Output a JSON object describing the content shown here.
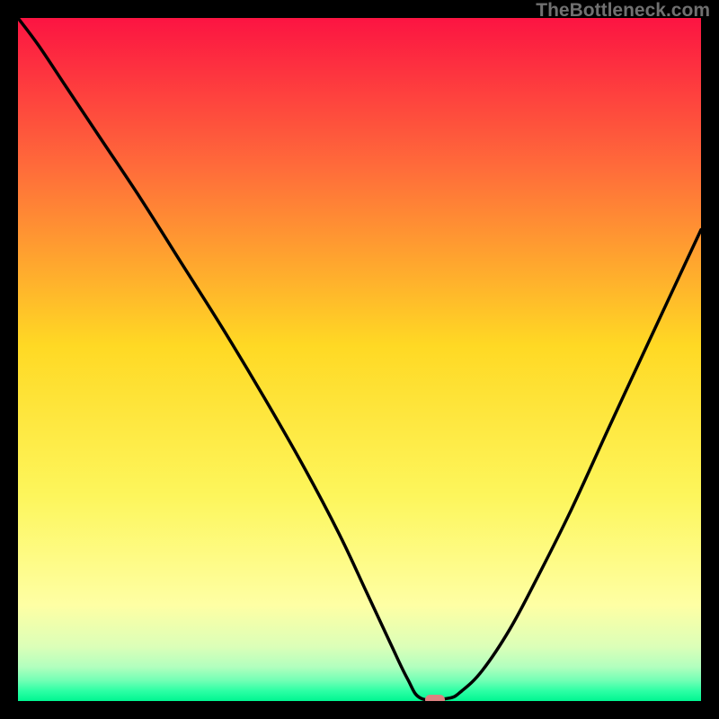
{
  "watermark": "TheBottleneck.com",
  "colors": {
    "top": "#fc1442",
    "mid_upper": "#ff6c3a",
    "mid": "#ffd924",
    "mid_lower": "#fdf65c",
    "pale_yellow": "#feffa4",
    "pale_green1": "#dcffb8",
    "pale_green2": "#b2ffbe",
    "green1": "#72ffb5",
    "green2": "#2dffa5",
    "green3": "#00f691",
    "pill": "#dd8181",
    "curve": "#000000",
    "border": "#000000"
  },
  "chart_data": {
    "type": "line",
    "title": "",
    "xlabel": "",
    "ylabel": "",
    "xlim": [
      0,
      100
    ],
    "ylim": [
      0,
      100
    ],
    "x": [
      0,
      3,
      7,
      12,
      18,
      24,
      30,
      36,
      42,
      47,
      51,
      54.5,
      57,
      59,
      63,
      65,
      68,
      72,
      76,
      81,
      86.5,
      93,
      100
    ],
    "values": [
      100,
      96,
      90,
      82.5,
      73.5,
      64,
      54.5,
      44.5,
      34,
      24.5,
      16,
      8.5,
      3.3,
      0.4,
      0.4,
      1.5,
      4.5,
      10.5,
      18,
      28,
      40,
      54,
      69
    ],
    "dip_marker": {
      "x": 61,
      "y": 0.2
    },
    "background_gradient": "vertical red→orange→yellow→green",
    "note": "Bottleneck-style V curve; values estimated from pixels on a 0–100 scale on both axes."
  }
}
